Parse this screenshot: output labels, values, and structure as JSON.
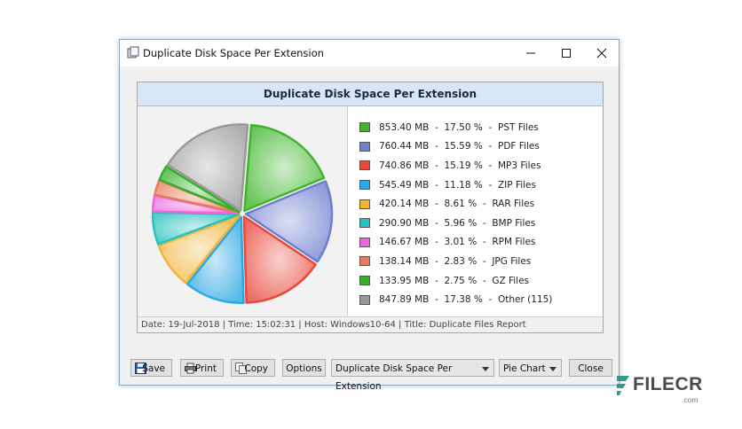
{
  "window": {
    "title": "Duplicate Disk Space Per Extension"
  },
  "chart_panel": {
    "title": "Duplicate Disk Space Per Extension",
    "footer": "Date: 19-Jul-2018 | Time: 15:02:31 | Host: Windows10-64 | Title: Duplicate Files Report"
  },
  "chart_data": {
    "type": "pie",
    "title": "Duplicate Disk Space Per Extension",
    "slices": [
      {
        "label": "PST Files",
        "size": "853.40 MB",
        "percent": 17.5,
        "percent_text": "17.50 %",
        "color": "#3fb52a"
      },
      {
        "label": "PDF Files",
        "size": "760.44 MB",
        "percent": 15.59,
        "percent_text": "15.59 %",
        "color": "#6f7fd0"
      },
      {
        "label": "MP3 Files",
        "size": "740.86 MB",
        "percent": 15.19,
        "percent_text": "15.19 %",
        "color": "#e8493c"
      },
      {
        "label": "ZIP Files",
        "size": "545.49 MB",
        "percent": 11.18,
        "percent_text": "11.18 %",
        "color": "#2aa8e4"
      },
      {
        "label": "RAR Files",
        "size": "420.14 MB",
        "percent": 8.61,
        "percent_text": "8.61 %",
        "color": "#f0b43a"
      },
      {
        "label": "BMP Files",
        "size": "290.90 MB",
        "percent": 5.96,
        "percent_text": "5.96 %",
        "color": "#26c2c0"
      },
      {
        "label": "RPM Files",
        "size": "146.67 MB",
        "percent": 3.01,
        "percent_text": "3.01 %",
        "color": "#ee66dd"
      },
      {
        "label": "JPG Files",
        "size": "138.14 MB",
        "percent": 2.83,
        "percent_text": "2.83 %",
        "color": "#e57c5a"
      },
      {
        "label": "GZ Files",
        "size": "133.95 MB",
        "percent": 2.75,
        "percent_text": "2.75 %",
        "color": "#34b02a"
      },
      {
        "label": "Other (115)",
        "size": "847.89 MB",
        "percent": 17.38,
        "percent_text": "17.38 %",
        "color": "#9a9a9a"
      }
    ]
  },
  "toolbar": {
    "save_label": "Save",
    "print_label": "Print",
    "copy_label": "Copy",
    "options_label": "Options",
    "report_select_value": "Duplicate Disk Space Per Extension",
    "chart_type_value": "Pie Chart",
    "close_label": "Close"
  },
  "watermark": {
    "brand": "FILECR",
    "suffix": ".com"
  },
  "icons": {
    "app": "app-icon",
    "minimize": "minimize-icon",
    "maximize": "maximize-icon",
    "close": "close-icon",
    "save": "floppy-icon",
    "print": "printer-icon",
    "copy": "copy-icon"
  }
}
